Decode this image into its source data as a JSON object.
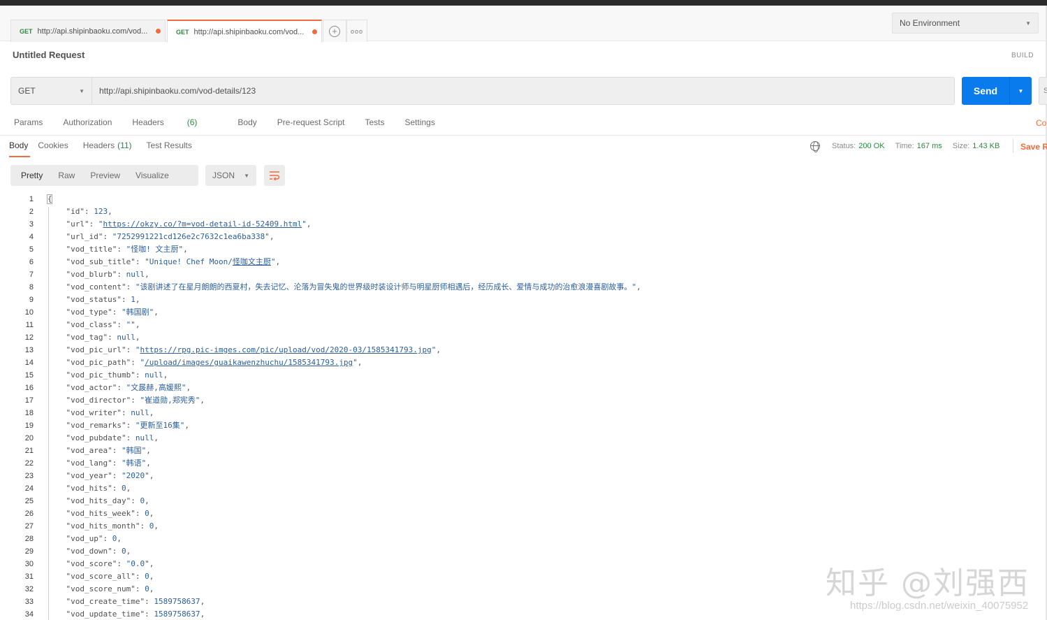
{
  "tabs": [
    {
      "method": "GET",
      "url": "http://api.shipinbaoku.com/vod..."
    },
    {
      "method": "GET",
      "url": "http://api.shipinbaoku.com/vod..."
    }
  ],
  "environment": "No Environment",
  "request_title": "Untitled Request",
  "build_label": "BUILD",
  "method": "GET",
  "url": "http://api.shipinbaoku.com/vod-details/123",
  "send_label": "Send",
  "request_tabs": {
    "params": "Params",
    "authorization": "Authorization",
    "headers": "Headers",
    "headers_count": "(6)",
    "body": "Body",
    "prerequest": "Pre-request Script",
    "tests": "Tests",
    "settings": "Settings",
    "cookies_link": "Co"
  },
  "response_tabs": {
    "body": "Body",
    "cookies": "Cookies",
    "headers": "Headers",
    "headers_count": "(11)",
    "test_results": "Test Results"
  },
  "status": {
    "status_label": "Status:",
    "status_value": "200 OK",
    "time_label": "Time:",
    "time_value": "167 ms",
    "size_label": "Size:",
    "size_value": "1.43 KB",
    "save_label": "Save R"
  },
  "view": {
    "pretty": "Pretty",
    "raw": "Raw",
    "preview": "Preview",
    "visualize": "Visualize",
    "format": "JSON"
  },
  "code_lines": [
    {
      "n": "1",
      "parts": [
        [
          "p",
          "{"
        ]
      ]
    },
    {
      "n": "2",
      "parts": [
        [
          "p",
          "    \"id\": "
        ],
        [
          "v",
          "123"
        ],
        [
          "p",
          ","
        ]
      ]
    },
    {
      "n": "3",
      "parts": [
        [
          "p",
          "    \"url\": "
        ],
        [
          "v",
          "\""
        ],
        [
          "a",
          "https://okzy.co/?m=vod-detail-id-52409.html"
        ],
        [
          "v",
          "\""
        ],
        [
          "p",
          ","
        ]
      ]
    },
    {
      "n": "4",
      "parts": [
        [
          "p",
          "    \"url_id\": "
        ],
        [
          "v",
          "\"7252991221cd126e2c7632c1ea6ba338\""
        ],
        [
          "p",
          ","
        ]
      ]
    },
    {
      "n": "5",
      "parts": [
        [
          "p",
          "    \"vod_title\": "
        ],
        [
          "v",
          "\"怪咖! 文主厨\""
        ],
        [
          "p",
          ","
        ]
      ]
    },
    {
      "n": "6",
      "parts": [
        [
          "p",
          "    \"vod_sub_title\": "
        ],
        [
          "v",
          "\"Unique! Chef Moon/"
        ],
        [
          "a",
          "怪咖文主厨"
        ],
        [
          "v",
          "\""
        ],
        [
          "p",
          ","
        ]
      ]
    },
    {
      "n": "7",
      "parts": [
        [
          "p",
          "    \"vod_blurb\": "
        ],
        [
          "v",
          "null"
        ],
        [
          "p",
          ","
        ]
      ]
    },
    {
      "n": "8",
      "parts": [
        [
          "p",
          "    \"vod_content\": "
        ],
        [
          "v",
          "\"该剧讲述了在星月朗朗的西夏村，失去记忆、沦落为冒失鬼的世界级时装设计师与明星厨师相遇后，经历成长、爱情与成功的治愈浪漫喜剧故事。\""
        ],
        [
          "p",
          ","
        ]
      ]
    },
    {
      "n": "9",
      "parts": [
        [
          "p",
          "    \"vod_status\": "
        ],
        [
          "v",
          "1"
        ],
        [
          "p",
          ","
        ]
      ]
    },
    {
      "n": "10",
      "parts": [
        [
          "p",
          "    \"vod_type\": "
        ],
        [
          "v",
          "\"韩国剧\""
        ],
        [
          "p",
          ","
        ]
      ]
    },
    {
      "n": "11",
      "parts": [
        [
          "p",
          "    \"vod_class\": "
        ],
        [
          "v",
          "\"\""
        ],
        [
          "p",
          ","
        ]
      ]
    },
    {
      "n": "12",
      "parts": [
        [
          "p",
          "    \"vod_tag\": "
        ],
        [
          "v",
          "null"
        ],
        [
          "p",
          ","
        ]
      ]
    },
    {
      "n": "13",
      "parts": [
        [
          "p",
          "    \"vod_pic_url\": "
        ],
        [
          "v",
          "\""
        ],
        [
          "a",
          "https://rpg.pic-imges.com/pic/upload/vod/2020-03/1585341793.jpg"
        ],
        [
          "v",
          "\""
        ],
        [
          "p",
          ","
        ]
      ]
    },
    {
      "n": "14",
      "parts": [
        [
          "p",
          "    \"vod_pic_path\": "
        ],
        [
          "v",
          "\""
        ],
        [
          "a",
          "/upload/images/guaikawenzhuchu/1585341793.jpg"
        ],
        [
          "v",
          "\""
        ],
        [
          "p",
          ","
        ]
      ]
    },
    {
      "n": "15",
      "parts": [
        [
          "p",
          "    \"vod_pic_thumb\": "
        ],
        [
          "v",
          "null"
        ],
        [
          "p",
          ","
        ]
      ]
    },
    {
      "n": "16",
      "parts": [
        [
          "p",
          "    \"vod_actor\": "
        ],
        [
          "v",
          "\"文晸赫,高媛熙\""
        ],
        [
          "p",
          ","
        ]
      ]
    },
    {
      "n": "17",
      "parts": [
        [
          "p",
          "    \"vod_director\": "
        ],
        [
          "v",
          "\"崔道勋,郑宪秀\""
        ],
        [
          "p",
          ","
        ]
      ]
    },
    {
      "n": "18",
      "parts": [
        [
          "p",
          "    \"vod_writer\": "
        ],
        [
          "v",
          "null"
        ],
        [
          "p",
          ","
        ]
      ]
    },
    {
      "n": "19",
      "parts": [
        [
          "p",
          "    \"vod_remarks\": "
        ],
        [
          "v",
          "\"更新至16集\""
        ],
        [
          "p",
          ","
        ]
      ]
    },
    {
      "n": "20",
      "parts": [
        [
          "p",
          "    \"vod_pubdate\": "
        ],
        [
          "v",
          "null"
        ],
        [
          "p",
          ","
        ]
      ]
    },
    {
      "n": "21",
      "parts": [
        [
          "p",
          "    \"vod_area\": "
        ],
        [
          "v",
          "\"韩国\""
        ],
        [
          "p",
          ","
        ]
      ]
    },
    {
      "n": "22",
      "parts": [
        [
          "p",
          "    \"vod_lang\": "
        ],
        [
          "v",
          "\"韩语\""
        ],
        [
          "p",
          ","
        ]
      ]
    },
    {
      "n": "23",
      "parts": [
        [
          "p",
          "    \"vod_year\": "
        ],
        [
          "v",
          "\"2020\""
        ],
        [
          "p",
          ","
        ]
      ]
    },
    {
      "n": "24",
      "parts": [
        [
          "p",
          "    \"vod_hits\": "
        ],
        [
          "v",
          "0"
        ],
        [
          "p",
          ","
        ]
      ]
    },
    {
      "n": "25",
      "parts": [
        [
          "p",
          "    \"vod_hits_day\": "
        ],
        [
          "v",
          "0"
        ],
        [
          "p",
          ","
        ]
      ]
    },
    {
      "n": "26",
      "parts": [
        [
          "p",
          "    \"vod_hits_week\": "
        ],
        [
          "v",
          "0"
        ],
        [
          "p",
          ","
        ]
      ]
    },
    {
      "n": "27",
      "parts": [
        [
          "p",
          "    \"vod_hits_month\": "
        ],
        [
          "v",
          "0"
        ],
        [
          "p",
          ","
        ]
      ]
    },
    {
      "n": "28",
      "parts": [
        [
          "p",
          "    \"vod_up\": "
        ],
        [
          "v",
          "0"
        ],
        [
          "p",
          ","
        ]
      ]
    },
    {
      "n": "29",
      "parts": [
        [
          "p",
          "    \"vod_down\": "
        ],
        [
          "v",
          "0"
        ],
        [
          "p",
          ","
        ]
      ]
    },
    {
      "n": "30",
      "parts": [
        [
          "p",
          "    \"vod_score\": "
        ],
        [
          "v",
          "\"0.0\""
        ],
        [
          "p",
          ","
        ]
      ]
    },
    {
      "n": "31",
      "parts": [
        [
          "p",
          "    \"vod_score_all\": "
        ],
        [
          "v",
          "0"
        ],
        [
          "p",
          ","
        ]
      ]
    },
    {
      "n": "32",
      "parts": [
        [
          "p",
          "    \"vod_score_num\": "
        ],
        [
          "v",
          "0"
        ],
        [
          "p",
          ","
        ]
      ]
    },
    {
      "n": "33",
      "parts": [
        [
          "p",
          "    \"vod_create_time\": "
        ],
        [
          "v",
          "1589758637"
        ],
        [
          "p",
          ","
        ]
      ]
    },
    {
      "n": "34",
      "parts": [
        [
          "p",
          "    \"vod_update_time\": "
        ],
        [
          "v",
          "1589758637"
        ],
        [
          "p",
          ","
        ]
      ]
    }
  ],
  "watermark": {
    "text": "知乎 @刘强西",
    "url": "https://blog.csdn.net/weixin_40075952"
  },
  "colors": {
    "accent": "#f26b3a",
    "send": "#097bed",
    "success": "#2b8a3e",
    "json_value": "#2b5e9c"
  }
}
